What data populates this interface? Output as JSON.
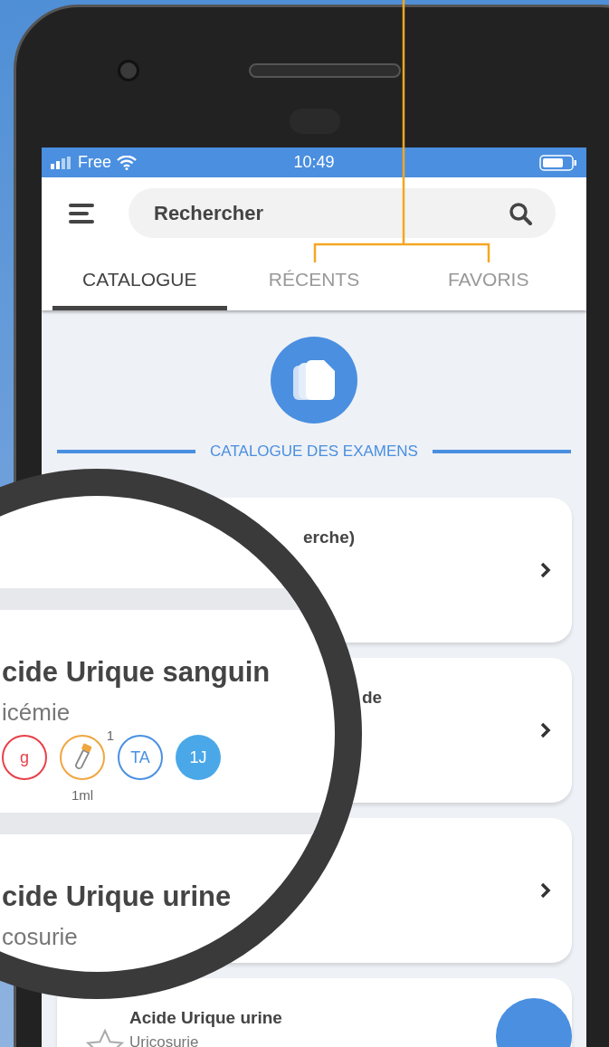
{
  "status_bar": {
    "carrier": "Free",
    "time": "10:49"
  },
  "search": {
    "placeholder": "Rechercher"
  },
  "tabs": [
    {
      "label": "CATALOGUE",
      "selected": true
    },
    {
      "label": "RÉCENTS",
      "selected": false
    },
    {
      "label": "FAVORIS",
      "selected": false
    }
  ],
  "section_title": "CATALOGUE DES EXAMENS",
  "cards": [
    {
      "title": "erche)",
      "chevron": true
    },
    {
      "title": "de",
      "chevron": true
    },
    {
      "chevron": true
    },
    {
      "title": "Acide Urique urine",
      "subtitle": "Uricosurie",
      "chevron": false
    }
  ],
  "magnifier": {
    "items": [
      {
        "title": "cide Urique sanguin",
        "subtitle": "icémie",
        "badges": [
          {
            "kind": "text",
            "label": "g",
            "color": "#e8404a"
          },
          {
            "kind": "tube",
            "count": "1",
            "caption": "1ml",
            "color": "#f0a640"
          },
          {
            "kind": "text",
            "label": "TA",
            "color": "#4a90e2"
          },
          {
            "kind": "filled",
            "label": "1J",
            "color": "#4aa8e8"
          }
        ]
      },
      {
        "title": "cide Urique urine",
        "subtitle": "cosurie"
      }
    ]
  }
}
